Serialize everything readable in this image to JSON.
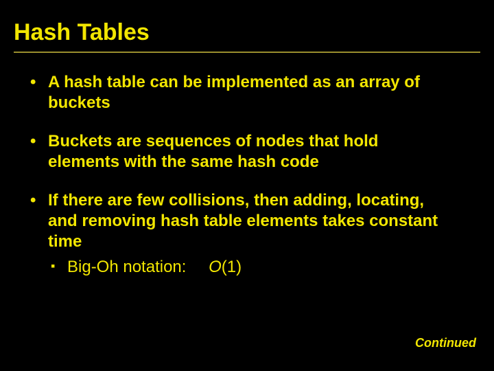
{
  "title": "Hash Tables",
  "bullets": {
    "b1": "A hash table can be implemented as an array of buckets",
    "b2": "Buckets are sequences of nodes that hold elements with the same hash code",
    "b3": "If there are few collisions, then adding, locating, and removing hash table elements takes constant time",
    "b3_sub_label": "Big-Oh notation:",
    "b3_sub_value_o": "O",
    "b3_sub_value_rest": "(1)"
  },
  "footer": "Continued"
}
